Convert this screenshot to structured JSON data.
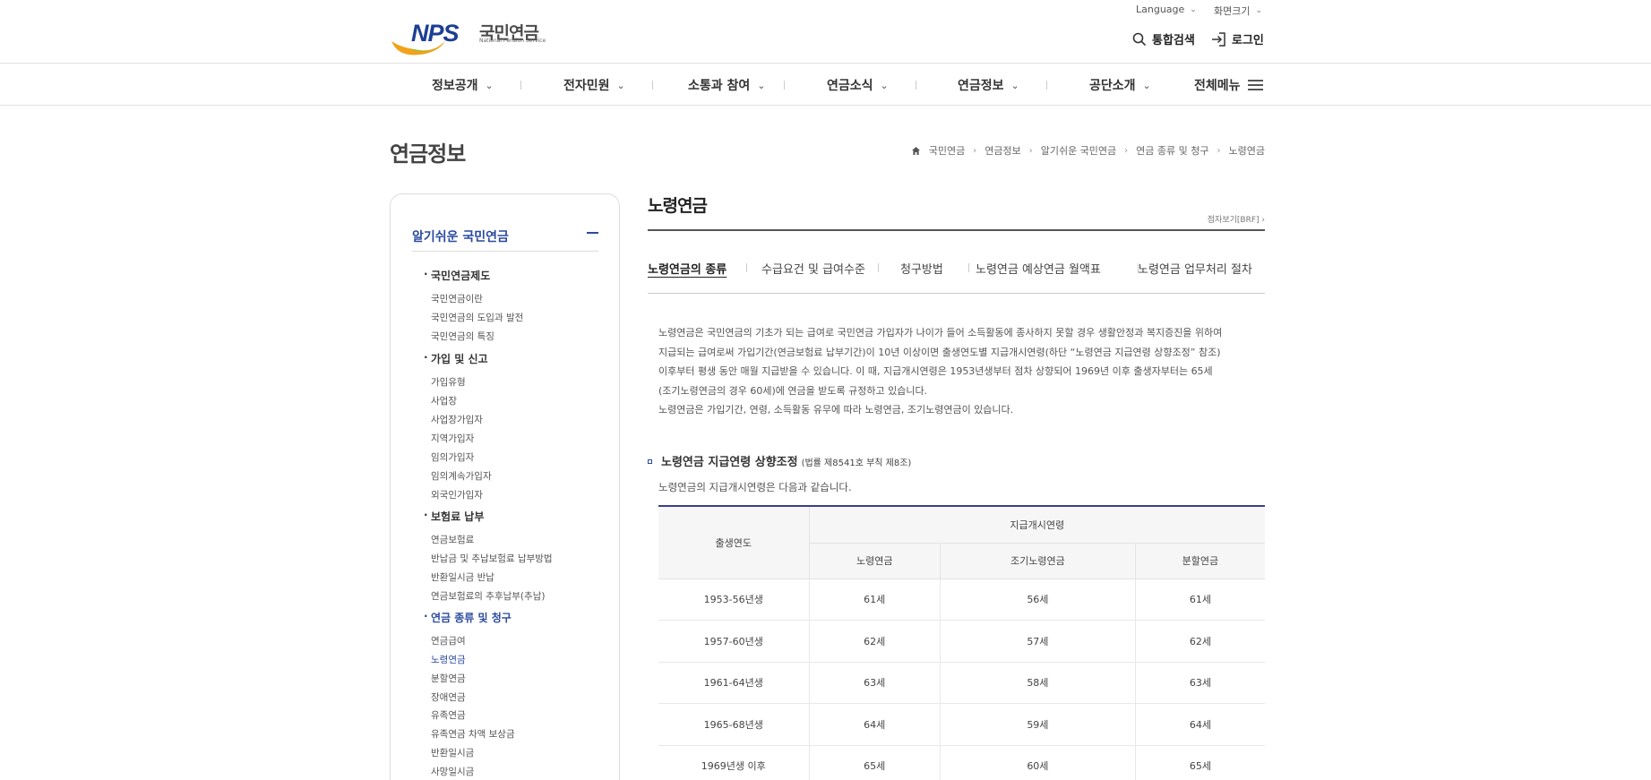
{
  "header": {
    "logo_text_kr": "국민연금",
    "logo_text_en": "National Pension Service",
    "logo_letters": "NPS",
    "language_label": "Language",
    "font_size_label": "화면크기",
    "search_label": "통합검색",
    "login_label": "로그인"
  },
  "gnb": {
    "items": [
      "정보공개",
      "전자민원",
      "소통과 참여",
      "연금소식",
      "연금정보",
      "공단소개"
    ],
    "all_menu_label": "전체메뉴"
  },
  "page": {
    "title": "연금정보",
    "breadcrumb": [
      "국민연금",
      "연금정보",
      "알기쉬운 국민연금",
      "연금 종류 및 청구",
      "노령연금"
    ]
  },
  "lnb": {
    "title": "알기쉬운 국민연금",
    "groups": [
      {
        "label": "국민연금제도",
        "items": [
          "국민연금이란",
          "국민연금의 도입과 발전",
          "국민연금의 특징"
        ]
      },
      {
        "label": "가입 및 신고",
        "items": [
          "가입유형",
          "사업장",
          "사업장가입자",
          "지역가입자",
          "임의가입자",
          "임의계속가입자",
          "외국인가입자"
        ]
      },
      {
        "label": "보험료 납부",
        "items": [
          "연금보험료",
          "반납금 및 추납보험료 납부방법",
          "반환일시금 반납",
          "연금보험료의 추후납부(추납)"
        ]
      },
      {
        "label": "연금 종류 및 청구",
        "items": [
          "연금급여",
          "노령연금",
          "분할연금",
          "장애연금",
          "유족연금",
          "유족연금 차액 보상금",
          "반환일시금",
          "사망일시금"
        ]
      }
    ]
  },
  "content": {
    "title": "노령연금",
    "brf_label": "점자보기[BRF]",
    "tabs": [
      "노령연금의 종류",
      "수급요건 및 급여수준",
      "청구방법",
      "노령연금 예상연금 월액표",
      "노령연금 업무처리 절차"
    ],
    "intro_lines": [
      "노령연금은 국민연금의 기초가 되는 급여로 국민연금 가입자가 나이가 들어 소득활동에 종사하지 못할 경우 생활안정과 복지증진을 위하여",
      "지급되는 급여로써 가입기간(연금보험료 납부기간)이 10년 이상이면 출생연도별 지급개시연령(하단 “노령연금 지급연령 상향조정” 참조)",
      "이후부터 평생 동안 매월 지급받을 수 있습니다. 이 때, 지급개시연령은 1953년생부터 점차 상향되어 1969년 이후 출생자부터는 65세",
      "(조기노령연금의 경우 60세)에 연금을 받도록 규정하고 있습니다.",
      "노령연금은 가입기간, 연령, 소득활동 유무에 따라 노령연금, 조기노령연금이 있습니다."
    ],
    "section_title": "노령연금 지급연령 상향조정",
    "section_note": "(법률 제8541호 부칙 제8조)",
    "section_desc": "노령연금의 지급개시연령은 다음과 같습니다.",
    "table": {
      "col_year": "출생연도",
      "col_group": "지급개시연령",
      "sub_cols": [
        "노령연금",
        "조기노령연금",
        "분할연금"
      ],
      "rows": [
        [
          "1953-56년생",
          "61세",
          "56세",
          "61세"
        ],
        [
          "1957-60년생",
          "62세",
          "57세",
          "62세"
        ],
        [
          "1961-64년생",
          "63세",
          "58세",
          "63세"
        ],
        [
          "1965-68년생",
          "64세",
          "59세",
          "64세"
        ],
        [
          "1969년생 이후",
          "65세",
          "60세",
          "65세"
        ]
      ]
    }
  }
}
